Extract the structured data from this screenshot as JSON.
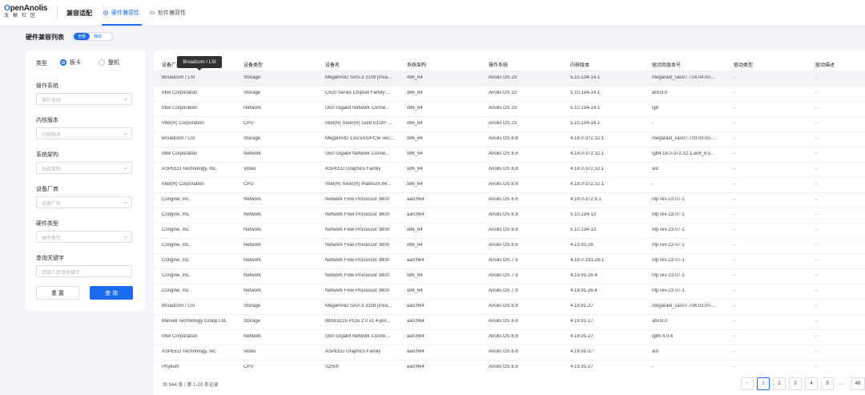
{
  "header": {
    "logo_main": "OpenAnolis",
    "logo_sub": "龙蜥社区",
    "app_title": "兼容适配",
    "tabs": [
      {
        "label": "硬件兼容性",
        "active": true
      },
      {
        "label": "软件兼容性",
        "active": false
      }
    ]
  },
  "page": {
    "title": "硬件兼容列表",
    "segment": [
      "全部",
      "我的"
    ]
  },
  "filters": {
    "type_label": "类型",
    "type_options": [
      "板卡",
      "整机"
    ],
    "fields": [
      {
        "label": "操作系统",
        "placeholder": "操作系统"
      },
      {
        "label": "内核版本",
        "placeholder": "内核版本"
      },
      {
        "label": "系统架构",
        "placeholder": "系统架构"
      },
      {
        "label": "设备厂商",
        "placeholder": "设备厂商"
      },
      {
        "label": "硬件类型",
        "placeholder": "硬件类型"
      },
      {
        "label": "查询关键字",
        "placeholder": "请输入查询关键字"
      }
    ],
    "reset_label": "重 置",
    "query_label": "查 询"
  },
  "table": {
    "columns": [
      "设备厂商",
      "设备类型",
      "设备名",
      "系统架构",
      "操作系统",
      "内核版本",
      "驱动及版本号",
      "驱动类型",
      "驱动描述"
    ],
    "tooltip": "Broadcom / LSI",
    "rows": [
      [
        "Broadcom / LSI",
        "Storage",
        "MegaRAID SAS-3 3108 [Inva...",
        "x86_64",
        "Anolis OS 23",
        "5.10.134-14.1",
        "megaraid_sas07.714.04.00-...",
        "-",
        "-"
      ],
      [
        "Intel Corporation",
        "Storage",
        "C620 Series Chipset Family ...",
        "x86_64",
        "Anolis OS 23",
        "5.10.134-14.1",
        "ahci3.0",
        "-",
        "-"
      ],
      [
        "Intel Corporation",
        "Network",
        "I350 Gigabit Network Conne...",
        "x86_64",
        "Anolis OS 23",
        "5.10.134-14.1",
        "igb",
        "-",
        "-"
      ],
      [
        "Intel(R) Corporation",
        "CPU",
        "Intel(R) Xeon(R) Gold 5318Y ...",
        "x86_64",
        "Anolis OS 23",
        "5.10.134-14.1",
        "-",
        "-",
        "-"
      ],
      [
        "Broadcom / LSI",
        "Storage",
        "MegaRAID 12GSAS/PCIe Sec...",
        "x86_64",
        "Anolis OS 8.8",
        "4.18.0-372.32.1",
        "megaraid_sas07.719.03.00-...",
        "-",
        "-"
      ],
      [
        "Intel Corporation",
        "Network",
        "I350 Gigabit Network Conne...",
        "x86_64",
        "Anolis OS 8.8",
        "4.18.0-372.32.1",
        "igb4.18.0-372.32.1.an8_6.x...",
        "-",
        "-"
      ],
      [
        "ASPEED Technology, Inc.",
        "Video",
        "ASPEED Graphics Family",
        "x86_64",
        "Anolis OS 8.8",
        "4.18.0-372.32.1",
        "ast",
        "-",
        "-"
      ],
      [
        "Intel(R) Corporation",
        "CPU",
        "Intel(R) Xeon(R) Platinum 84...",
        "x86_64",
        "Anolis OS 8.8",
        "4.18.0-372.32.1",
        "-",
        "-",
        "-"
      ],
      [
        "Corigine, Inc.",
        "Network",
        "Network Flow Processor 3800",
        "aarch64",
        "Anolis OS 8.6",
        "4.18.0-372.9.1",
        "nfp rev-23.07-1",
        "-",
        "-"
      ],
      [
        "Corigine, Inc.",
        "Network",
        "Network Flow Processor 3800",
        "aarch64",
        "Anolis OS 8.8",
        "5.10.134-13",
        "nfp rev-23.07-1",
        "-",
        "-"
      ],
      [
        "Corigine, Inc.",
        "Network",
        "Network Flow Processor 3800",
        "x86_64",
        "Anolis OS 8.8",
        "5.10.134-13",
        "nfp rev-23.07-1",
        "-",
        "-"
      ],
      [
        "Corigine, Inc.",
        "Network",
        "Network Flow Processor 3800",
        "x86_64",
        "Anolis OS 8.6",
        "4.19.91-26",
        "nfp rev-23.07-1",
        "-",
        "-"
      ],
      [
        "Corigine, Inc.",
        "Network",
        "Network Flow Processor 3800",
        "aarch64",
        "Anolis OS 7.9",
        "4.18.0-193.28.1",
        "nfp rev-23.07-1",
        "-",
        "-"
      ],
      [
        "Corigine, Inc.",
        "Network",
        "Network Flow Processor 3800",
        "x86_64",
        "Anolis OS 7.9",
        "4.19.91-26.4",
        "nfp rev-23.07-1",
        "-",
        "-"
      ],
      [
        "Corigine, Inc.",
        "Network",
        "Network Flow Processor 3800",
        "x86_64",
        "Anolis OS 7.9",
        "4.19.91-26.4",
        "nfp rev-23.07-1",
        "-",
        "-"
      ],
      [
        "Broadcom / LSI",
        "Storage",
        "MegaRAID SAS-3 3108 [Inva...",
        "aarch64",
        "Anolis OS 8.8",
        "4.19.91-27",
        "megaraid_sas07.706.03.00-...",
        "-",
        "-"
      ],
      [
        "Marvell Technology Group Ltd.",
        "Storage",
        "88SE9215 PCIe 2.0 x1 4-por...",
        "aarch64",
        "Anolis OS 8.8",
        "4.19.91-27",
        "ahci3.0",
        "-",
        "-"
      ],
      [
        "Intel Corporation",
        "Network",
        "I350 Gigabit Network Conne...",
        "aarch64",
        "Anolis OS 8.8",
        "4.19.91-27",
        "igb5.4.0-k",
        "-",
        "-"
      ],
      [
        "ASPEED Technology, Inc.",
        "Video",
        "ASPEED Graphics Family",
        "aarch64",
        "Anolis OS 8.8",
        "4.19.91-27",
        "ast",
        "-",
        "-"
      ],
      [
        "Phytium",
        "CPU",
        "S2500",
        "aarch64",
        "Anolis OS 8.8",
        "4.19.91-27",
        "-",
        "-",
        "-"
      ]
    ]
  },
  "pagination": {
    "summary": "共 944 条 / 第 1-20 条记录",
    "prev": "<",
    "pages": [
      "1",
      "2",
      "3",
      "4",
      "5"
    ],
    "ellipsis": "···",
    "last": "48",
    "active_page": "1"
  },
  "colors": {
    "accent": "#1c6bef",
    "background": "#f3f4f7"
  }
}
